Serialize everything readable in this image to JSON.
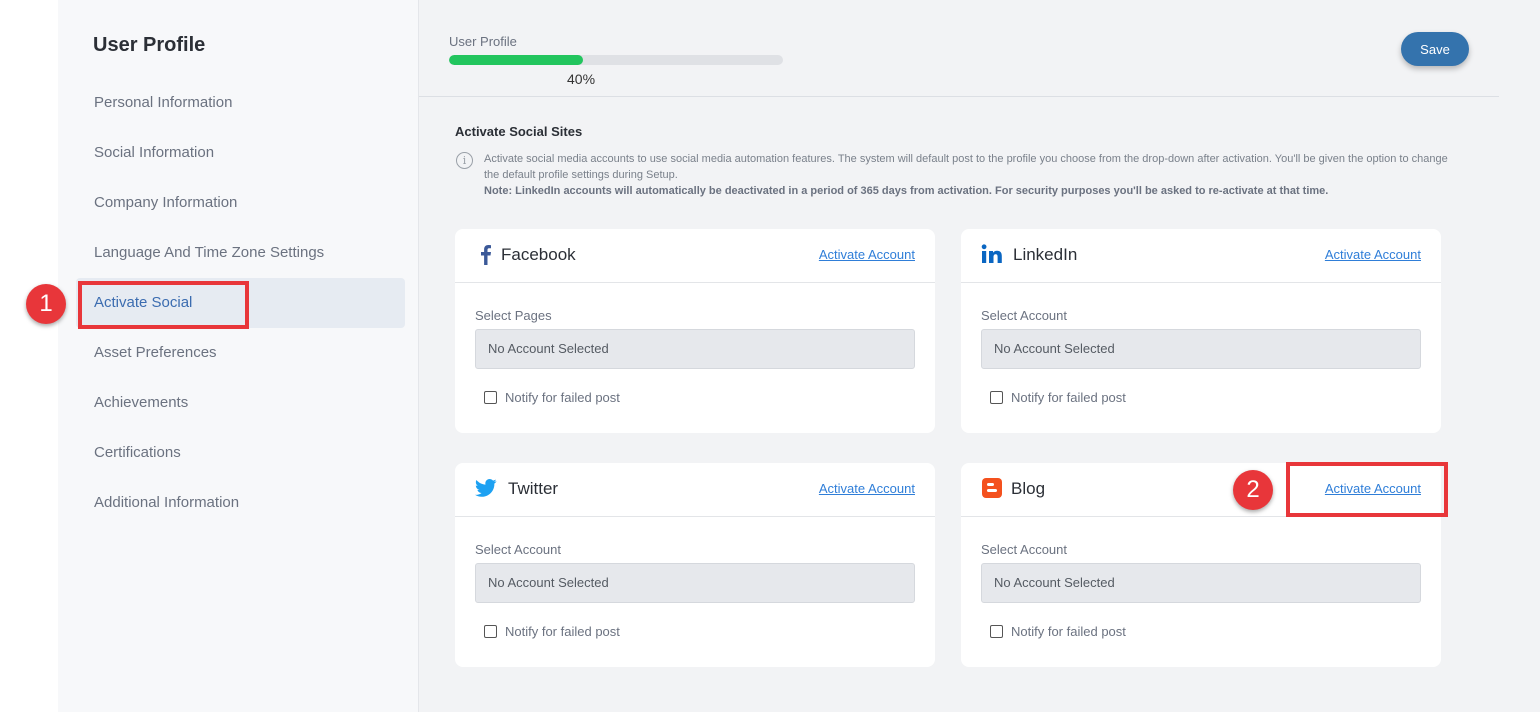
{
  "sidebar": {
    "title": "User Profile",
    "items": [
      {
        "label": "Personal Information"
      },
      {
        "label": "Social Information"
      },
      {
        "label": "Company Information"
      },
      {
        "label": "Language And Time Zone Settings"
      },
      {
        "label": "Activate Social",
        "active": true
      },
      {
        "label": "Asset Preferences"
      },
      {
        "label": "Achievements"
      },
      {
        "label": "Certifications"
      },
      {
        "label": "Additional Information"
      }
    ]
  },
  "header": {
    "progress_label": "User Profile",
    "progress_value": 40,
    "progress_text": "40%",
    "save_label": "Save"
  },
  "section": {
    "title": "Activate Social Sites",
    "info_icon": "info-icon",
    "info_text": "Activate social media accounts to use social media automation features. The system will default post to the profile you choose from the drop-down after activation. You'll be given the option to change the default profile settings during Setup.",
    "note": "Note: LinkedIn accounts will automatically be deactivated in a period of 365 days from activation. For security purposes you'll be asked to re-activate at that time."
  },
  "cards": [
    {
      "name": "Facebook",
      "icon": "facebook-icon",
      "activate": "Activate Account",
      "field_label": "Select Pages",
      "select_value": "No Account Selected",
      "notify": "Notify for failed post"
    },
    {
      "name": "LinkedIn",
      "icon": "linkedin-icon",
      "activate": "Activate Account",
      "field_label": "Select Account",
      "select_value": "No Account Selected",
      "notify": "Notify for failed post"
    },
    {
      "name": "Twitter",
      "icon": "twitter-icon",
      "activate": "Activate Account",
      "field_label": "Select Account",
      "select_value": "No Account Selected",
      "notify": "Notify for failed post"
    },
    {
      "name": "Blog",
      "icon": "blogger-icon",
      "activate": "Activate Account",
      "field_label": "Select Account",
      "select_value": "No Account Selected",
      "notify": "Notify for failed post"
    }
  ],
  "annotations": {
    "step1": "1",
    "step2": "2"
  },
  "colors": {
    "accent": "#3473ad",
    "progress": "#22c55e",
    "link": "#2f7ed8",
    "annotation": "#e8363a",
    "facebook": "#3b5998",
    "linkedin": "#0a66c2",
    "twitter": "#1da1f2",
    "blogger": "#f4511e"
  }
}
